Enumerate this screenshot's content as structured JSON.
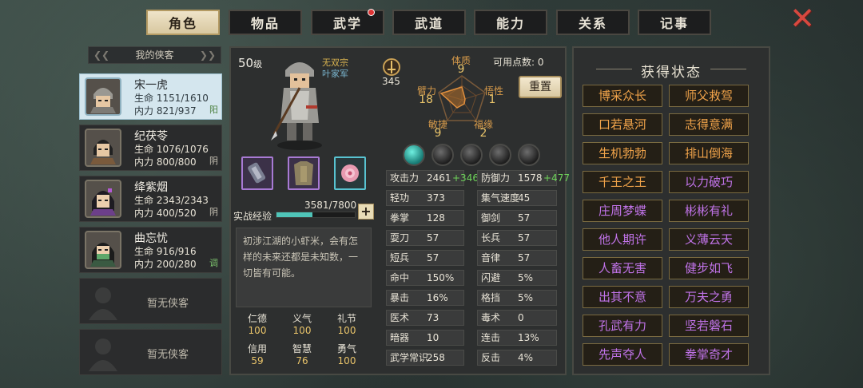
{
  "tabs": [
    {
      "label": "角色",
      "active": true
    },
    {
      "label": "物品",
      "active": false
    },
    {
      "label": "武学",
      "active": false,
      "badge": true
    },
    {
      "label": "武道",
      "active": false
    },
    {
      "label": "能力",
      "active": false
    },
    {
      "label": "关系",
      "active": false
    },
    {
      "label": "记事",
      "active": false
    }
  ],
  "close_icon": "close-x-icon",
  "roster": {
    "header": "我的侠客",
    "members": [
      {
        "name": "宋一虎",
        "hp": "生命 1151/1610",
        "mp": "内力 821/937",
        "tag": "阳",
        "selected": true
      },
      {
        "name": "纪茯苓",
        "hp": "生命 1076/1076",
        "mp": "内力 800/800",
        "tag": "阴",
        "selected": false
      },
      {
        "name": "绛紫烟",
        "hp": "生命 2343/2343",
        "mp": "内力 400/520",
        "tag": "阴",
        "selected": false
      },
      {
        "name": "曲忘忧",
        "hp": "生命 916/916",
        "mp": "内力 200/280",
        "tag": "调",
        "selected": false
      }
    ],
    "empty_label": "暂无侠客"
  },
  "character": {
    "level": "50",
    "level_unit": "级",
    "title1": "无双宗",
    "title2": "叶家军",
    "power": "345",
    "available_points_label": "可用点数:",
    "available_points": "0",
    "reset_label": "重置",
    "attributes": {
      "tizhi": {
        "label": "体质",
        "value": "9"
      },
      "wuxing": {
        "label": "悟性",
        "value": "1"
      },
      "fuyuan": {
        "label": "福缘",
        "value": "2"
      },
      "minjie": {
        "label": "敏捷",
        "value": "9"
      },
      "bili": {
        "label": "臂力",
        "value": "18"
      }
    },
    "exp_label": "实战经验",
    "exp_value": "3581/7800",
    "exp_fraction": 0.459,
    "description": "初涉江湖的小虾米，会有怎样的未来还都是未知数，一切皆有可能。",
    "virtues": [
      {
        "k": "仁德",
        "v": "100"
      },
      {
        "k": "义气",
        "v": "100"
      },
      {
        "k": "礼节",
        "v": "100"
      },
      {
        "k": "信用",
        "v": "59"
      },
      {
        "k": "智慧",
        "v": "76"
      },
      {
        "k": "勇气",
        "v": "100"
      }
    ],
    "stats_left": [
      {
        "k": "攻击力",
        "v": "2461",
        "b": "+346"
      },
      {
        "k": "轻功",
        "v": "373"
      },
      {
        "k": "拳掌",
        "v": "128"
      },
      {
        "k": "耍刀",
        "v": "57"
      },
      {
        "k": "短兵",
        "v": "57"
      },
      {
        "k": "命中",
        "v": "150%"
      },
      {
        "k": "暴击",
        "v": "16%"
      },
      {
        "k": "医术",
        "v": "73"
      },
      {
        "k": "暗器",
        "v": "10"
      },
      {
        "k": "武学常识",
        "v": "258"
      }
    ],
    "stats_right": [
      {
        "k": "防御力",
        "v": "1578",
        "b": "+477"
      },
      {
        "k": "集气速度",
        "v": "45"
      },
      {
        "k": "御剑",
        "v": "57"
      },
      {
        "k": "长兵",
        "v": "57"
      },
      {
        "k": "音律",
        "v": "57"
      },
      {
        "k": "闪避",
        "v": "5%"
      },
      {
        "k": "格挡",
        "v": "5%"
      },
      {
        "k": "毒术",
        "v": "0"
      },
      {
        "k": "连击",
        "v": "13%"
      },
      {
        "k": "反击",
        "v": "4%"
      }
    ]
  },
  "status_panel": {
    "title": "获得状态",
    "items": [
      {
        "label": "博采众长",
        "color": "orange"
      },
      {
        "label": "师父救驾",
        "color": "orange"
      },
      {
        "label": "口若悬河",
        "color": "orange"
      },
      {
        "label": "志得意满",
        "color": "orange"
      },
      {
        "label": "生机勃勃",
        "color": "orange"
      },
      {
        "label": "排山倒海",
        "color": "orange"
      },
      {
        "label": "千王之王",
        "color": "orange"
      },
      {
        "label": "以力破巧",
        "color": "purple"
      },
      {
        "label": "庄周梦蝶",
        "color": "purple"
      },
      {
        "label": "彬彬有礼",
        "color": "purple"
      },
      {
        "label": "他人期许",
        "color": "purple"
      },
      {
        "label": "义薄云天",
        "color": "purple"
      },
      {
        "label": "人畜无害",
        "color": "purple"
      },
      {
        "label": "健步如飞",
        "color": "purple"
      },
      {
        "label": "出其不意",
        "color": "purple"
      },
      {
        "label": "万夫之勇",
        "color": "purple"
      },
      {
        "label": "孔武有力",
        "color": "purple"
      },
      {
        "label": "坚若磐石",
        "color": "purple"
      },
      {
        "label": "先声夺人",
        "color": "purple"
      },
      {
        "label": "拳掌奇才",
        "color": "purple"
      }
    ]
  }
}
